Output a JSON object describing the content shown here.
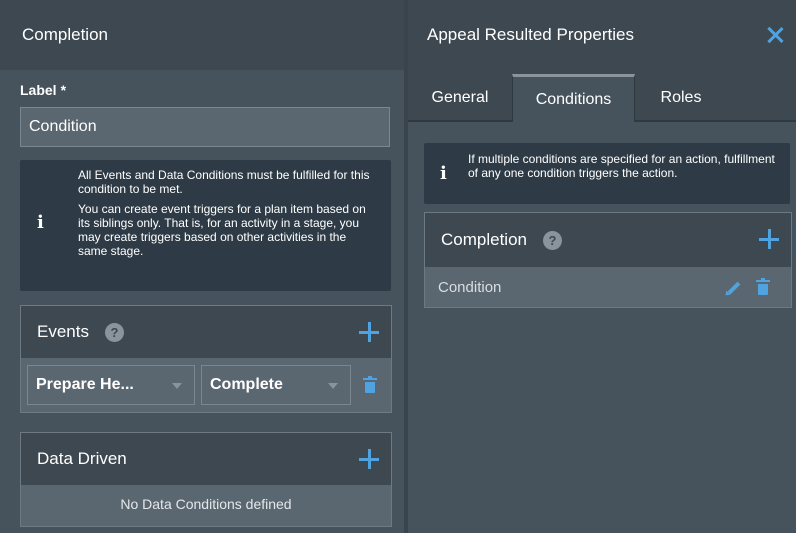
{
  "left": {
    "title": "Completion",
    "label_field": {
      "label": "Label",
      "required_mark": "*",
      "value": "Condition"
    },
    "info": {
      "icon": "info-icon",
      "line1": "All Events and Data Conditions must be fulfilled for this condition to be met.",
      "line2": "You can create event triggers for a plan item based on its siblings only. That is, for an activity in a stage, you may create triggers based on other activities in the same stage."
    },
    "events": {
      "title": "Events",
      "help": "?",
      "rows": [
        {
          "source": "Prepare He...",
          "event": "Complete"
        }
      ]
    },
    "data_driven": {
      "title": "Data Driven",
      "empty_text": "No Data Conditions defined"
    }
  },
  "right": {
    "title": "Appeal Resulted Properties",
    "tabs": [
      {
        "label": "General",
        "active": false
      },
      {
        "label": "Conditions",
        "active": true
      },
      {
        "label": "Roles",
        "active": false
      }
    ],
    "info": {
      "icon": "info-icon",
      "text": "If multiple conditions are specified for an action, fulfillment of any one condition triggers the action."
    },
    "completion": {
      "title": "Completion",
      "help": "?",
      "items": [
        {
          "label": "Condition"
        }
      ]
    }
  },
  "colors": {
    "panel": "#46525c",
    "header": "#3e4850",
    "info_bg": "#2e3b46",
    "accent": "#4fa3e0"
  }
}
